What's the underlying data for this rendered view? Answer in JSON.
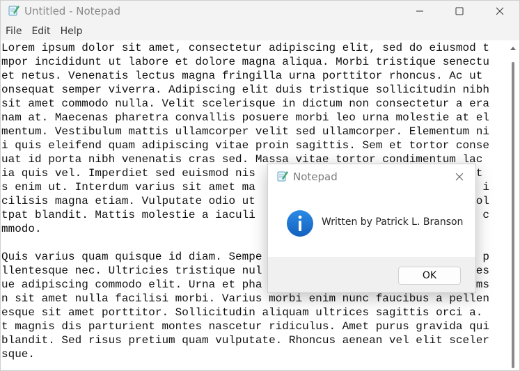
{
  "window": {
    "title": "Untitled - Notepad",
    "icon": "notepad-icon",
    "controls": [
      "minimize-icon",
      "maximize-icon",
      "close-icon"
    ]
  },
  "menu": [
    "File",
    "Edit",
    "Help"
  ],
  "editor": {
    "lines": [
      "Lorem ipsum dolor sit amet, consectetur adipiscing elit, sed do eiusmod t",
      "mpor incididunt ut labore et dolore magna aliqua. Morbi tristique senectu",
      "et netus. Venenatis lectus magna fringilla urna porttitor rhoncus. Ac ut",
      "onsequat semper viverra. Adipiscing elit duis tristique sollicitudin nibh",
      "sit amet commodo nulla. Velit scelerisque in dictum non consectetur a era",
      "nam at. Maecenas pharetra convallis posuere morbi leo urna molestie at el",
      "mentum. Vestibulum mattis ullamcorper velit sed ullamcorper. Elementum ni",
      "i quis eleifend quam adipiscing vitae proin sagittis. Sem et tortor conse",
      "uat id porta nibh venenatis cras sed. Massa vitae tortor condimentum lac",
      "ia quis vel. Imperdiet sed euismod nis                              matt",
      "s enim ut. Interdum varius sit amet ma                              met i",
      "cilisis magna etiam. Vulputate odio ut                              s vol",
      "tpat blandit. Mattis molestie a iaculi                              ing c",
      "mmodo.",
      "",
      "Quis varius quam quisque id diam. Sempe                             uam p",
      "llentesque nec. Ultricies tristique nul                             entes",
      "ue adipiscing commodo elit. Urna et pha                             ccums",
      "n sit amet nulla facilisi morbi. Varius morbi enim nunc faucibus a pellen",
      "esque sit amet porttitor. Sollicitudin aliquam ultrices sagittis orci a.",
      "t magnis dis parturient montes nascetur ridiculus. Amet purus gravida qui",
      "blandit. Sed risus pretium quam vulputate. Rhoncus aenean vel elit sceler",
      "sque."
    ]
  },
  "dialog": {
    "title": "Notepad",
    "icon": "notepad-icon",
    "message_icon": "info-icon",
    "message": "Written by Patrick L. Branson",
    "ok_label": "OK"
  },
  "colors": {
    "info_blue": "#1e73d2",
    "chrome": "#f3f3f3"
  }
}
